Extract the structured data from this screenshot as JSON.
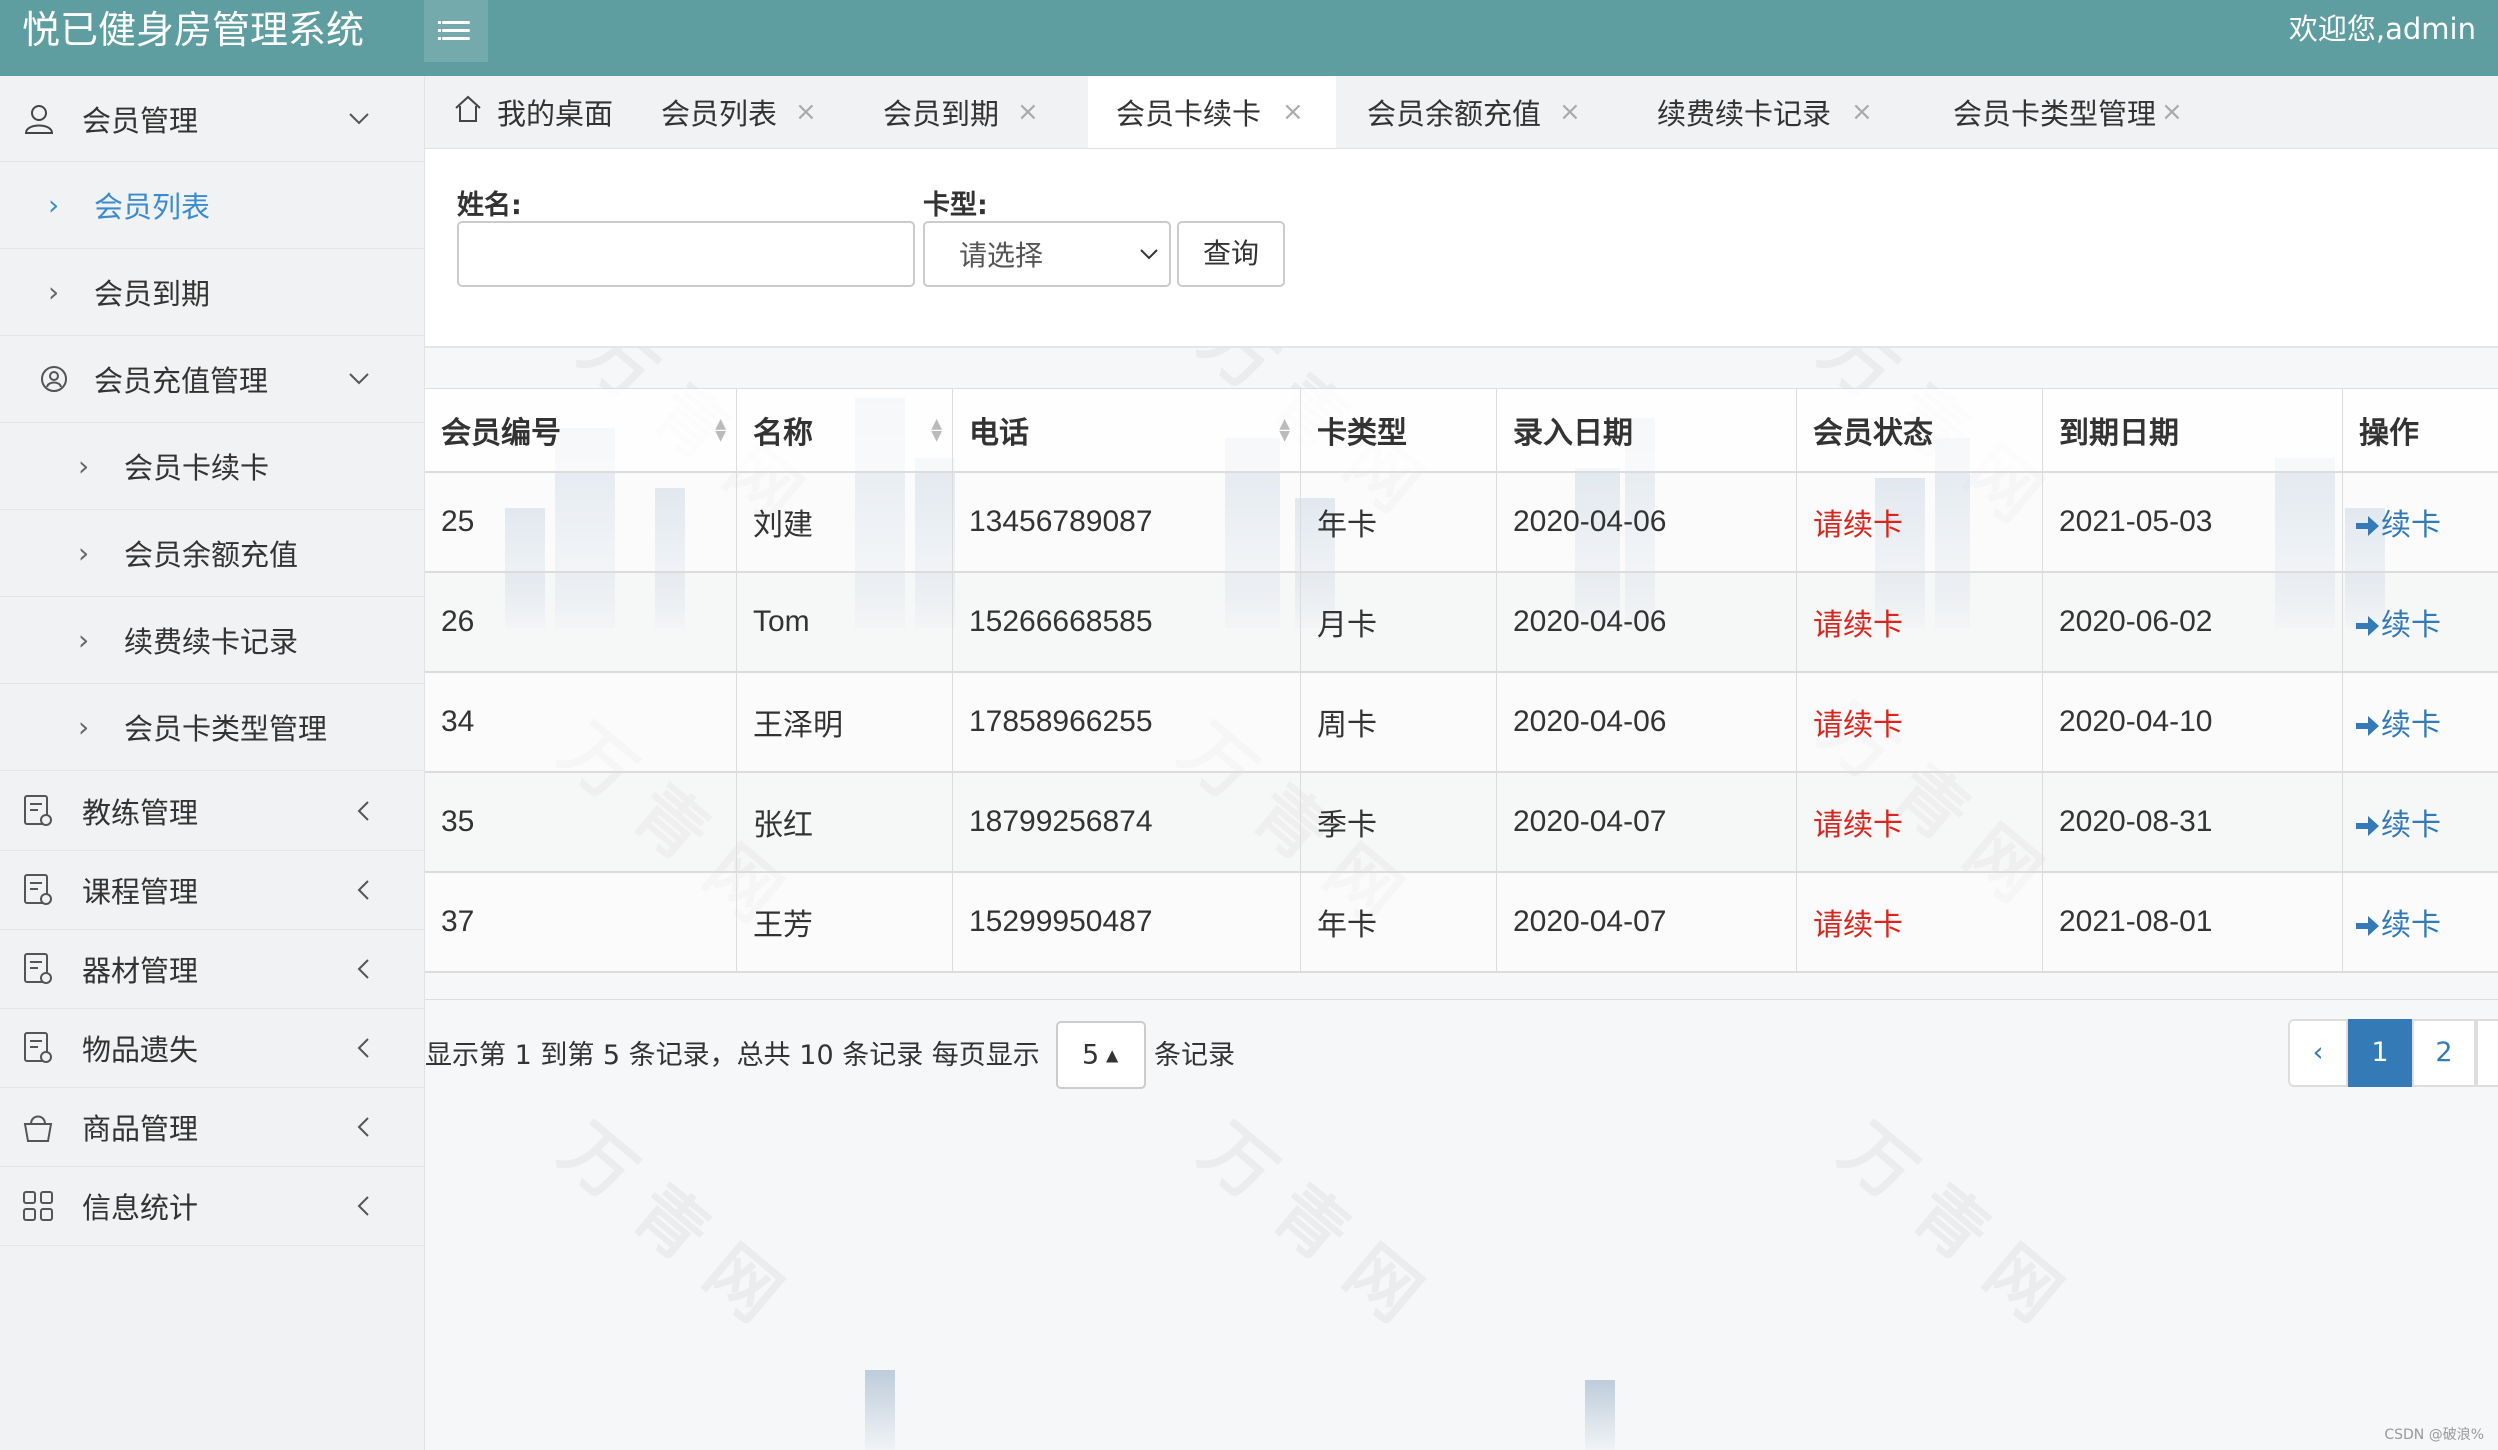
{
  "app": {
    "title": "悦已健身房管理系统",
    "welcome": "欢迎您,admin"
  },
  "sidebar": {
    "items": [
      {
        "label": "会员管理",
        "icon": "user-icon",
        "expanded": true
      },
      {
        "label": "会员列表",
        "active": true
      },
      {
        "label": "会员到期"
      },
      {
        "label": "会员充值管理",
        "icon": "user-circle-icon",
        "expanded": true
      },
      {
        "label": "会员卡续卡"
      },
      {
        "label": "会员余额充值"
      },
      {
        "label": "续费续卡记录"
      },
      {
        "label": "会员卡类型管理"
      },
      {
        "label": "教练管理",
        "icon": "document-icon"
      },
      {
        "label": "课程管理",
        "icon": "document-icon"
      },
      {
        "label": "器材管理",
        "icon": "document-icon"
      },
      {
        "label": "物品遗失",
        "icon": "document-icon"
      },
      {
        "label": "商品管理",
        "icon": "bag-icon"
      },
      {
        "label": "信息统计",
        "icon": "grid-icon"
      }
    ]
  },
  "tabs": [
    {
      "label": "我的桌面",
      "icon": "home-icon"
    },
    {
      "label": "会员列表"
    },
    {
      "label": "会员到期"
    },
    {
      "label": "会员卡续卡",
      "active": true
    },
    {
      "label": "会员余额充值"
    },
    {
      "label": "续费续卡记录"
    },
    {
      "label": "会员卡类型管理"
    }
  ],
  "close_glyph": "×",
  "search": {
    "name_label": "姓名:",
    "name_value": "",
    "card_label": "卡型:",
    "card_selected": "请选择",
    "query_label": "查询"
  },
  "table": {
    "headers": [
      "会员编号",
      "名称",
      "电话",
      "卡类型",
      "录入日期",
      "会员状态",
      "到期日期",
      "操作"
    ],
    "rows": [
      {
        "id": "25",
        "name": "刘建",
        "phone": "13456789087",
        "card": "年卡",
        "created": "2020-04-06",
        "status": "请续卡",
        "expire": "2021-05-03",
        "action": "续卡"
      },
      {
        "id": "26",
        "name": "Tom",
        "phone": "15266668585",
        "card": "月卡",
        "created": "2020-04-06",
        "status": "请续卡",
        "expire": "2020-06-02",
        "action": "续卡"
      },
      {
        "id": "34",
        "name": "王泽明",
        "phone": "17858966255",
        "card": "周卡",
        "created": "2020-04-06",
        "status": "请续卡",
        "expire": "2020-04-10",
        "action": "续卡"
      },
      {
        "id": "35",
        "name": "张红",
        "phone": "18799256874",
        "card": "季卡",
        "created": "2020-04-07",
        "status": "请续卡",
        "expire": "2020-08-31",
        "action": "续卡"
      },
      {
        "id": "37",
        "name": "王芳",
        "phone": "15299950487",
        "card": "年卡",
        "created": "2020-04-07",
        "status": "请续卡",
        "expire": "2021-08-01",
        "action": "续卡"
      }
    ]
  },
  "pagination": {
    "info": "显示第 1 到第 5 条记录，总共 10 条记录 每页显示",
    "page_size": "5",
    "suffix": "条记录",
    "prev": "‹",
    "pages": [
      "1",
      "2"
    ],
    "current": "1"
  },
  "colors": {
    "topbar": "#5f9ea0",
    "accent": "#337ab7",
    "status_red": "#d9251d"
  },
  "footer": {
    "watermark": "CSDN @破浪%"
  }
}
